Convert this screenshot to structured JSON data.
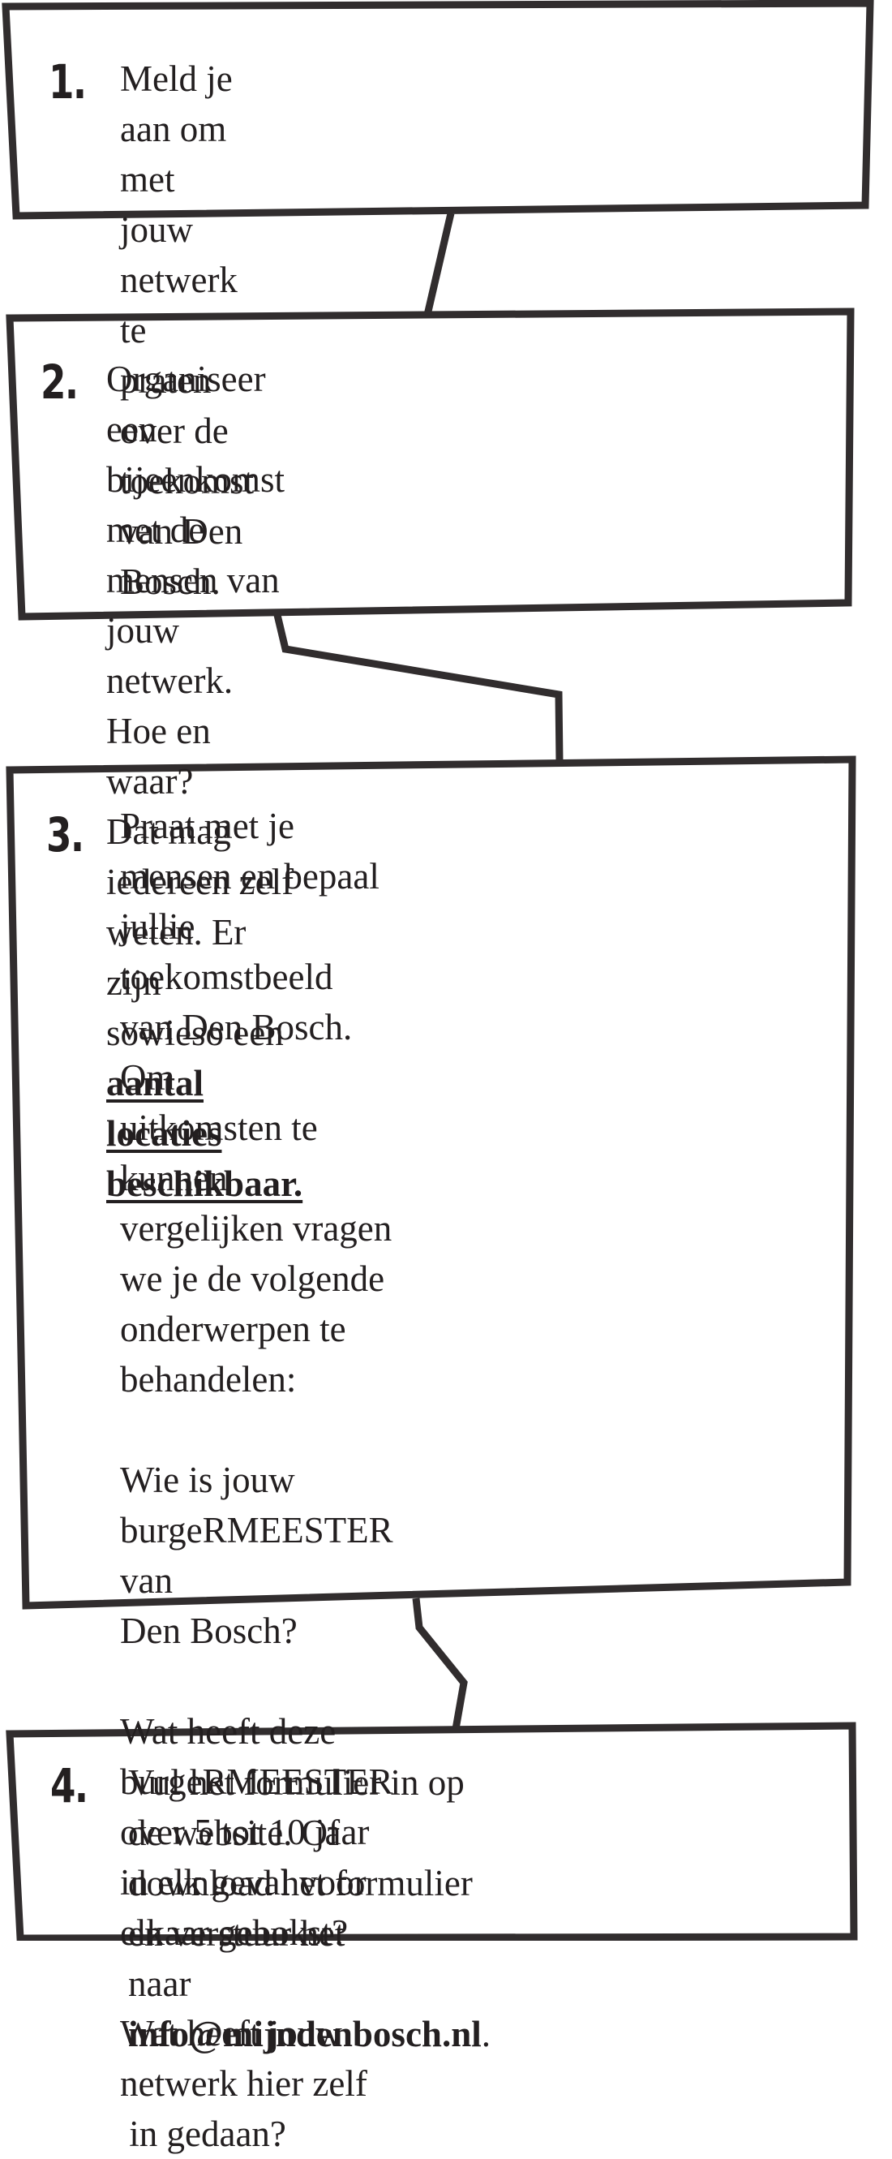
{
  "steps": [
    {
      "number": "1.",
      "lines": [
        "Meld je aan om met jouw netwerk te",
        "praten over de toekomst van Den Bosch."
      ]
    },
    {
      "number": "2.",
      "lines": [
        "Organiseer een bijeenkomst met de",
        "mensen van jouw netwerk. Hoe en waar?",
        "Dat mag iedereen zelf weten. Er zijn"
      ],
      "last_line_prefix": "sowieso een ",
      "link_text": "aantal locaties beschikbaar."
    },
    {
      "number": "3.",
      "intro_lines": [
        "Praat met je mensen en bepaal jullie",
        "toekomstbeeld van Den Bosch. Om",
        "uitkomsten te kunnen vergelijken vragen",
        "we je de volgende onderwerpen te",
        "behandelen:"
      ],
      "question_1": [
        "Wie is jouw burgeRMEESTER van",
        "Den Bosch?"
      ],
      "question_2": [
        "Wat heeft deze burgeRMEESTER",
        "over 5 tot 10 jaar in elk geval voor",
        "elkaar gebokst?"
      ],
      "question_3": [
        "Wat heeft jouw netwerk hier zelf",
        " in gedaan?"
      ]
    },
    {
      "number": "4.",
      "lines": [
        "Vul het formulier in op de website. Of",
        "download het formulier en verstuur het"
      ],
      "last_line_prefix": "naar ",
      "email": "info@mijndenbosch.nl",
      "last_line_suffix": "."
    }
  ]
}
